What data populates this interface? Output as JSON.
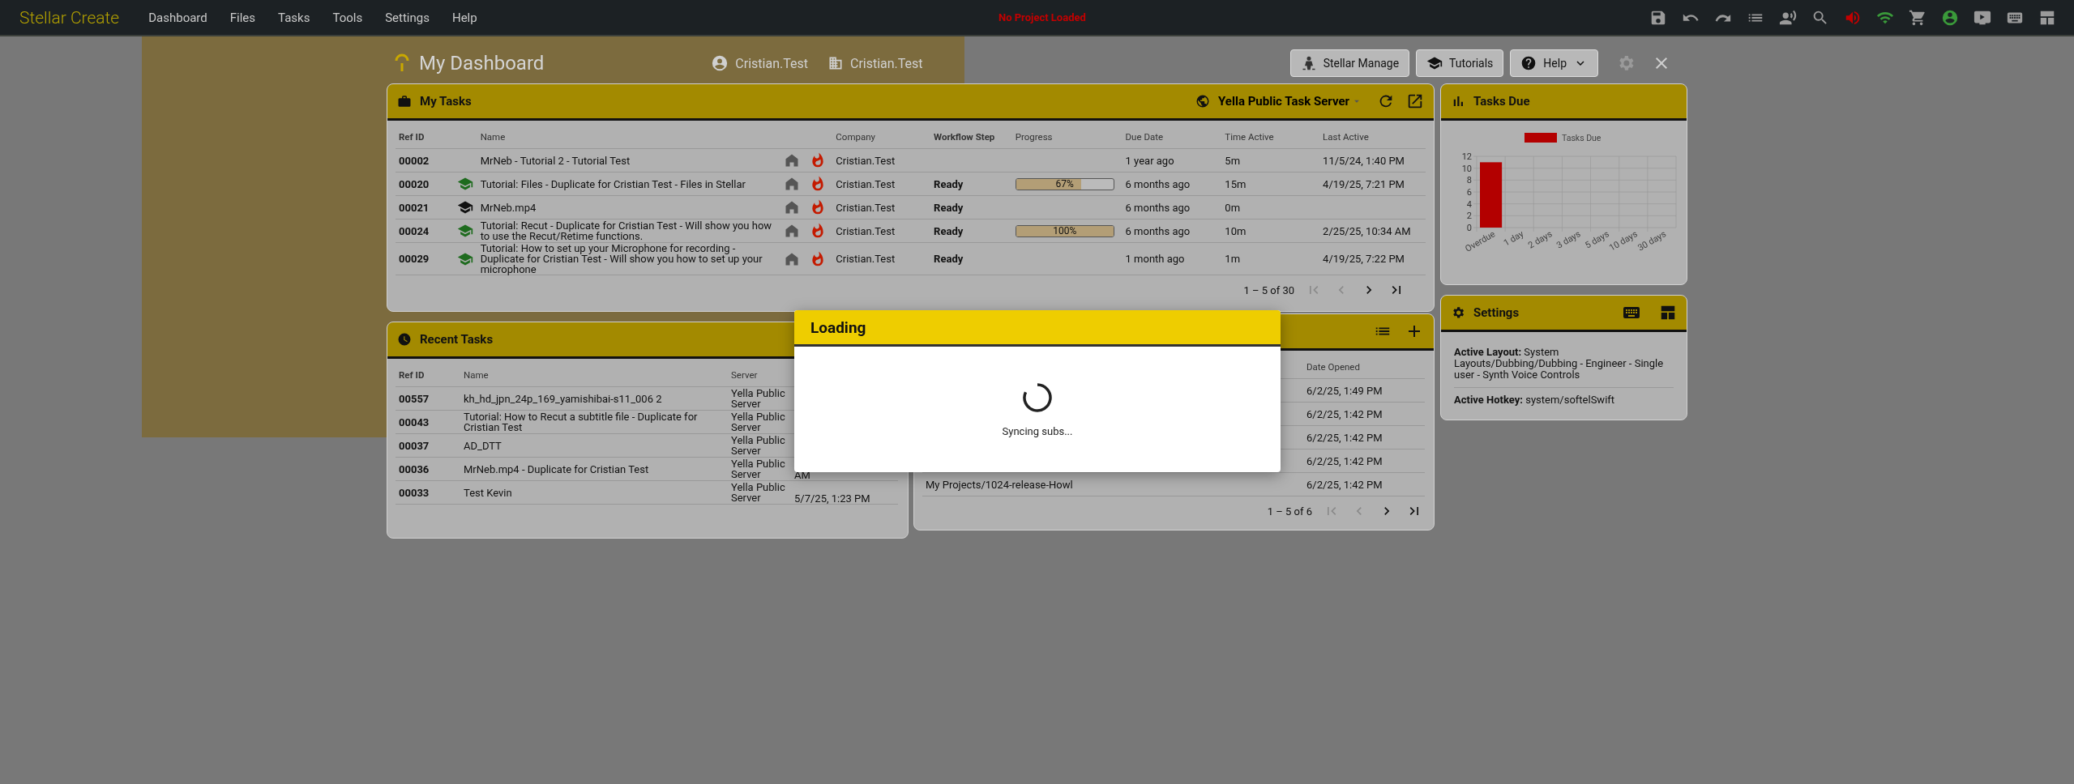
{
  "topbar": {
    "logo": "Stellar Create",
    "menu": [
      {
        "label": "Dashboard"
      },
      {
        "label": "Files"
      },
      {
        "label": "Tasks"
      },
      {
        "label": "Tools"
      },
      {
        "label": "Settings"
      },
      {
        "label": "Help"
      }
    ],
    "status": "No Project Loaded"
  },
  "dashboard": {
    "title": "My Dashboard",
    "user": "Cristian.Test",
    "company": "Cristian.Test",
    "buttons": [
      {
        "kind": "manage",
        "label": "Stellar Manage"
      },
      {
        "kind": "tutorials",
        "label": "Tutorials"
      },
      {
        "kind": "help",
        "label": "Help"
      }
    ]
  },
  "my_tasks": {
    "title": "My Tasks",
    "server": "Yella Public Task Server",
    "columns": [
      "Ref ID",
      "Name",
      "Company",
      "Workflow Step",
      "Progress",
      "Due Date",
      "Time Active",
      "Last Active"
    ],
    "rows": [
      {
        "ref": "00002",
        "kind": "plain",
        "name": "MrNeb - Tutorial 2 - Tutorial Test",
        "company": "Cristian.Test",
        "due": "1 year ago",
        "time": "5m",
        "last": "11/5/24, 1:40 PM"
      },
      {
        "ref": "00020",
        "kind": "tutorial",
        "name": "Tutorial: Files - Duplicate for Cristian Test - Files in Stellar",
        "company": "Cristian.Test",
        "step": "Ready",
        "progress": {
          "level": 0.67,
          "reading": "67%"
        },
        "due": "6 months ago",
        "time": "15m",
        "last": "4/19/25, 7:21 PM"
      },
      {
        "ref": "00021",
        "kind": "media",
        "name": "MrNeb.mp4",
        "company": "Cristian.Test",
        "step": "Ready",
        "due": "6 months ago",
        "time": "0m"
      },
      {
        "ref": "00024",
        "kind": "tutorial",
        "name": "Tutorial: Recut - Duplicate for Cristian Test - Will show you how to use the Recut/Retime functions.",
        "company": "Cristian.Test",
        "step": "Ready",
        "progress": {
          "level": 1,
          "reading": "100%"
        },
        "due": "6 months ago",
        "time": "10m",
        "last": "2/25/25, 10:34 AM"
      },
      {
        "ref": "00029",
        "kind": "tutorial",
        "name": "Tutorial: How to set up your Microphone for recording - Duplicate for Cristian Test - Will show you how to set up your microphone",
        "company": "Cristian.Test",
        "step": "Ready",
        "due": "1 month ago",
        "time": "1m",
        "last": "4/19/25, 7:22 PM"
      }
    ],
    "pagination": {
      "range": "1 – 5 of 30",
      "back_disabled": true
    }
  },
  "recent_tasks": {
    "title": "Recent Tasks",
    "columns": [
      "Ref ID",
      "Name",
      "Server"
    ],
    "rows": [
      {
        "ref": "00557",
        "name": "kh_hd_jpn_24p_169_yamishibai-s11_006 2",
        "server": "Yella Public Server"
      },
      {
        "ref": "00043",
        "name": "Tutorial: How to Recut a subtitle file - Duplicate for Cristian Test",
        "server": "Yella Public Server"
      },
      {
        "ref": "00037",
        "name": "AD_DTT",
        "server": "Yella Public Server"
      },
      {
        "ref": "00036",
        "name": "MrNeb.mp4 - Duplicate for Cristian Test",
        "server": "Yella Public Server",
        "column_4": "AM"
      },
      {
        "ref": "00033",
        "name": "Test Kevin",
        "server": "Yella Public Server",
        "column_4": "5/7/25, 1:23 PM"
      }
    ]
  },
  "projects": {
    "columns": [
      "Date Opened"
    ],
    "rows": [
      {
        "date": "6/2/25, 1:49 PM"
      },
      {
        "date": "6/2/25, 1:42 PM"
      },
      {
        "date": "6/2/25, 1:42 PM"
      },
      {
        "date": "6/2/25, 1:42 PM"
      },
      {
        "path": "My Projects/1024-release-Howl",
        "date": "6/2/25, 1:42 PM"
      }
    ],
    "pagination": {
      "range": "1 – 5 of 6",
      "back_disabled": true
    }
  },
  "tasks_due": {
    "title": "Tasks Due",
    "chart_data": {
      "type": "bar",
      "categories": [
        "Overdue",
        "1 day",
        "2 days",
        "3 days",
        "5 days",
        "10 days",
        "30 days"
      ],
      "series": [
        {
          "name": "Tasks Due",
          "color": "#b30000",
          "values": [
            11,
            0,
            0,
            0,
            0,
            0,
            0
          ]
        }
      ],
      "ylim": [
        0,
        12
      ],
      "grid": true,
      "yticks": [
        0,
        2,
        4,
        6,
        8,
        10,
        12
      ]
    }
  },
  "settings": {
    "title": "Settings",
    "items": [
      "**Active Layout:** System Layouts/Dubbing/Dubbing - Engineer - Single user - Synth Voice Controls",
      "**Active Hotkey:** system/softelSwift"
    ]
  },
  "loading": {
    "title": "Loading",
    "message": "Syncing subs..."
  }
}
